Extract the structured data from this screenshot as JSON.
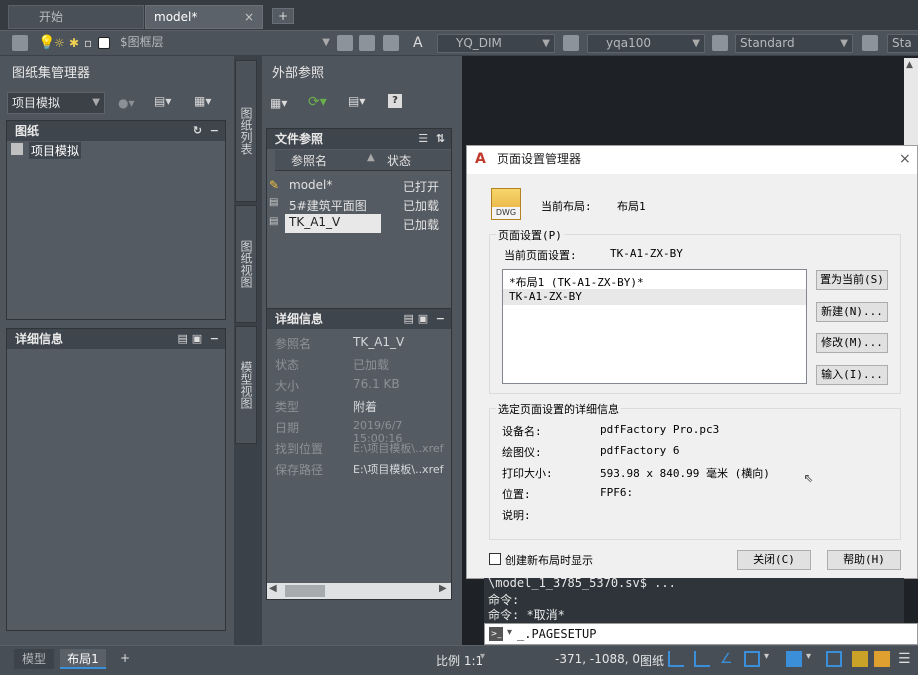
{
  "doc_tabs": {
    "start": "开始",
    "model": "model*",
    "close": "×",
    "plus": "+"
  },
  "toolbar": {
    "layer_value": "$图框层",
    "dimstyle": "YQ_DIM",
    "multileader": "yqa100",
    "tablestyle": "Standard",
    "textstyle_partial": "Sta"
  },
  "sheetset": {
    "title": "外部参照",
    "left_title": "图纸集管理器",
    "dropdown_value": "项目模拟",
    "sheets_header": "图纸",
    "tree_item": "项目模拟",
    "detail_header": "详细信息",
    "vtab_list": "图纸列表",
    "vtab_views": "图纸视图",
    "vtab_models": "模型视图"
  },
  "xref": {
    "file_header": "文件参照",
    "col_name": "参照名",
    "col_status": "状态",
    "rows": [
      {
        "name": "model*",
        "status": "已打开"
      },
      {
        "name": "5#建筑平面图",
        "status": "已加载"
      },
      {
        "name": "TK_A1_V",
        "status": "已加载"
      }
    ],
    "detail_header": "详细信息",
    "props": [
      {
        "label": "参照名",
        "value": "TK_A1_V"
      },
      {
        "label": "状态",
        "value": "已加载"
      },
      {
        "label": "大小",
        "value": "76.1 KB"
      },
      {
        "label": "类型",
        "value": "附着"
      },
      {
        "label": "日期",
        "value": "2019/6/7 15:00:16"
      },
      {
        "label": "找到位置",
        "value": "E:\\项目模板\\..xref"
      },
      {
        "label": "保存路径",
        "value": "E:\\项目模板\\..xref"
      }
    ]
  },
  "dialog": {
    "title": "页面设置管理器",
    "current_layout_label": "当前布局:",
    "current_layout_value": "布局1",
    "dwg_badge": "DWG",
    "pagesetup_group": "页面设置(P)",
    "current_pagesetup_label": "当前页面设置:",
    "current_pagesetup_value": "TK-A1-ZX-BY",
    "list_items": [
      "*布局1 (TK-A1-ZX-BY)*",
      "TK-A1-ZX-BY"
    ],
    "buttons": {
      "set_current": "置为当前(S)",
      "new": "新建(N)...",
      "modify": "修改(M)...",
      "import": "输入(I)...",
      "close": "关闭(C)",
      "help": "帮助(H)"
    },
    "details_group": "选定页面设置的详细信息",
    "details": [
      {
        "label": "设备名:",
        "value": "pdfFactory Pro.pc3"
      },
      {
        "label": "绘图仪:",
        "value": "pdfFactory 6"
      },
      {
        "label": "打印大小:",
        "value": "593.98 x 840.99 毫米 (横向)"
      },
      {
        "label": "位置:",
        "value": "FPF6:"
      },
      {
        "label": "说明:",
        "value": ""
      }
    ],
    "checkbox_label": "创建新布局时显示"
  },
  "command": {
    "lines": [
      "\\model_1_3785_5370.sv$ ...",
      "命令:",
      "命令: *取消*"
    ],
    "input": "_.PAGESETUP"
  },
  "status": {
    "tab_model": "模型",
    "tab_layout": "布局1",
    "plus": "+",
    "scale": "比例 1:1",
    "coords": "-371, -1088, 0",
    "paper": "图纸"
  },
  "colors": {
    "accent_blue": "#3a8fd8",
    "dialog_bg": "#f0f0f0",
    "panel_bg": "#4f555d"
  }
}
